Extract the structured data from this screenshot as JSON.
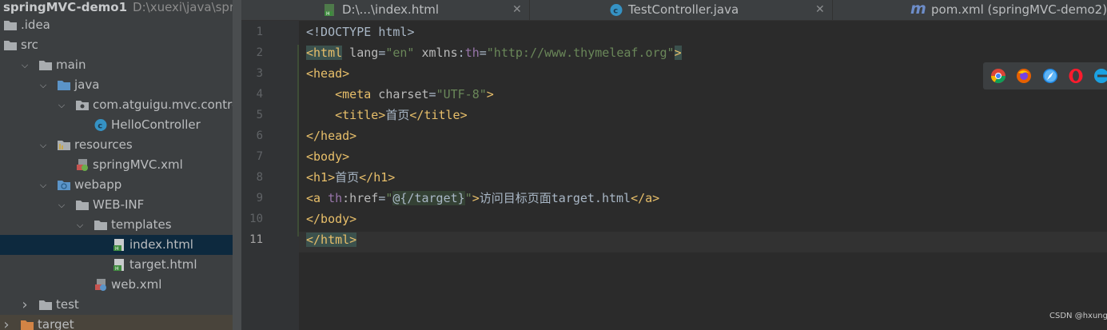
{
  "project": {
    "name": "springMVC-demo1",
    "path": "D:\\xuexi\\java\\springM"
  },
  "tree": [
    {
      "label": ".idea",
      "icon": "folder-icon",
      "expanded": null
    },
    {
      "label": "src",
      "icon": "folder-icon",
      "expanded": null
    },
    {
      "label": "main",
      "icon": "folder-icon",
      "expanded": true
    },
    {
      "label": "java",
      "icon": "source-folder-icon",
      "expanded": true
    },
    {
      "label": "com.atguigu.mvc.controller",
      "icon": "package-icon",
      "expanded": true
    },
    {
      "label": "HelloController",
      "icon": "class-icon",
      "expanded": null
    },
    {
      "label": "resources",
      "icon": "resources-folder-icon",
      "expanded": true
    },
    {
      "label": "springMVC.xml",
      "icon": "spring-xml-icon",
      "expanded": null
    },
    {
      "label": "webapp",
      "icon": "web-folder-icon",
      "expanded": true
    },
    {
      "label": "WEB-INF",
      "icon": "folder-icon",
      "expanded": true
    },
    {
      "label": "templates",
      "icon": "folder-icon",
      "expanded": true
    },
    {
      "label": "index.html",
      "icon": "html-file-icon",
      "expanded": null,
      "selected": true
    },
    {
      "label": "target.html",
      "icon": "html-file-icon",
      "expanded": null
    },
    {
      "label": "web.xml",
      "icon": "web-xml-icon",
      "expanded": null
    },
    {
      "label": "test",
      "icon": "folder-icon",
      "expanded": false
    },
    {
      "label": "target",
      "icon": "excluded-folder-icon",
      "expanded": false
    }
  ],
  "tabs": [
    {
      "label": "D:\\...\\index.html",
      "icon": "html-file-icon",
      "active": true
    },
    {
      "label": "TestController.java",
      "icon": "class-icon",
      "active": false
    },
    {
      "label": "pom.xml (springMVC-demo2)",
      "icon": "maven-icon",
      "active": false
    }
  ],
  "editor": {
    "line_numbers": [
      "1",
      "2",
      "3",
      "4",
      "5",
      "6",
      "7",
      "8",
      "9",
      "10",
      "11"
    ],
    "current_line": "11",
    "lines": [
      [
        {
          "t": "<!DOCTYPE ",
          "c": "tx"
        },
        {
          "t": "html",
          "c": "tx"
        },
        {
          "t": ">",
          "c": "tx"
        }
      ],
      [
        {
          "t": "<html",
          "c": "tg"
        },
        {
          "t": " lang",
          "c": "at"
        },
        {
          "t": "=",
          "c": "tx"
        },
        {
          "t": "\"en\"",
          "c": "st"
        },
        {
          "t": " xmlns",
          "c": "at"
        },
        {
          "t": ":",
          "c": "tx"
        },
        {
          "t": "th",
          "c": "ns"
        },
        {
          "t": "=",
          "c": "tx"
        },
        {
          "t": "\"http://www.thymeleaf.org\"",
          "c": "st"
        },
        {
          "t": ">",
          "c": "tg"
        }
      ],
      [
        {
          "t": "<head>",
          "c": "tg"
        }
      ],
      [
        {
          "t": "    ",
          "c": "tx"
        },
        {
          "t": "<meta",
          "c": "tg"
        },
        {
          "t": " charset",
          "c": "at"
        },
        {
          "t": "=",
          "c": "tx"
        },
        {
          "t": "\"UTF-8\"",
          "c": "st"
        },
        {
          "t": ">",
          "c": "tg"
        }
      ],
      [
        {
          "t": "    ",
          "c": "tx"
        },
        {
          "t": "<title>",
          "c": "tg"
        },
        {
          "t": "首页",
          "c": "tx"
        },
        {
          "t": "</title>",
          "c": "tg"
        }
      ],
      [
        {
          "t": "</head>",
          "c": "tg"
        }
      ],
      [
        {
          "t": "<body>",
          "c": "tg"
        }
      ],
      [
        {
          "t": "<h1>",
          "c": "tg"
        },
        {
          "t": "首页",
          "c": "tx"
        },
        {
          "t": "</h1>",
          "c": "tg"
        }
      ],
      [
        {
          "t": "<a",
          "c": "tg"
        },
        {
          "t": " th",
          "c": "ns"
        },
        {
          "t": ":href",
          "c": "at"
        },
        {
          "t": "=",
          "c": "tx"
        },
        {
          "t": "\"",
          "c": "st"
        },
        {
          "t": "@{/target}",
          "c": "ex"
        },
        {
          "t": "\"",
          "c": "st"
        },
        {
          "t": ">",
          "c": "tg"
        },
        {
          "t": "访问目标页面target.html",
          "c": "tx"
        },
        {
          "t": "</a>",
          "c": "tg"
        }
      ],
      [
        {
          "t": "</body>",
          "c": "tg"
        }
      ],
      [
        {
          "t": "</html>",
          "c": "tg"
        }
      ]
    ]
  },
  "browsers": [
    "chrome-icon",
    "firefox-icon",
    "safari-icon",
    "opera-icon",
    "edge-icon"
  ],
  "watermark": "CSDN @hxung"
}
